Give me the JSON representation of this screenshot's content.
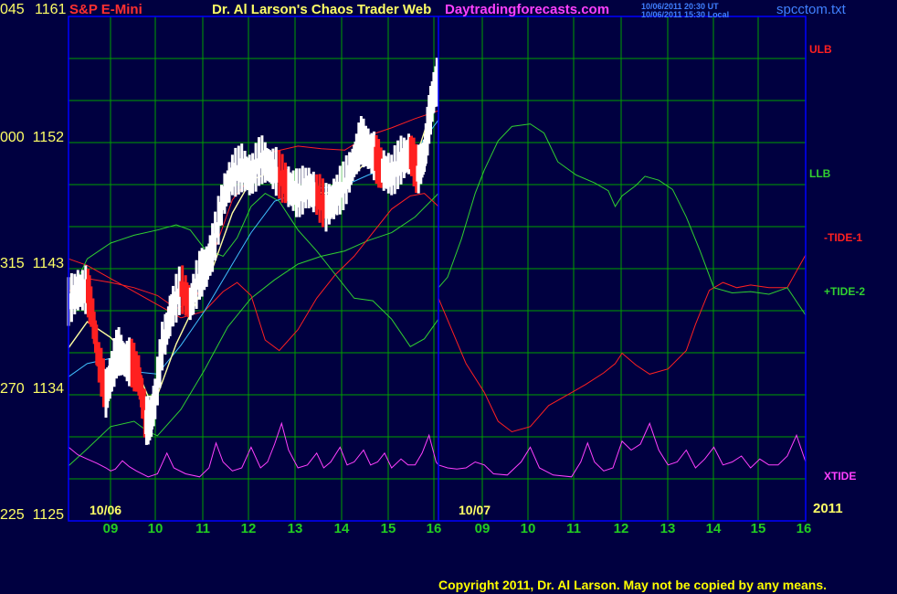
{
  "header": {
    "instrument": "S&P E-Mini",
    "site_title": "Dr. Al Larson's Chaos Trader Web",
    "site_url": "Daytradingforecasts.com",
    "ts_ut": "10/06/2011 20:30 UT",
    "ts_local": "10/06/2011 15:30 Local",
    "file_name": "spcctom.txt",
    "left_cut": "045"
  },
  "copyright": "Copyright 2011, Dr. Al Larson. May not be copied by any means.",
  "colors": {
    "background": "#000040",
    "grid": "#00a000",
    "frame": "#0000ff",
    "ulb": "#ff2020",
    "llb": "#30d030",
    "xtide": "#ff40ff",
    "price_up": "#ffffff",
    "price_down": "#ff2020",
    "avg_fast": "#ffffa0",
    "avg_slow": "#40c0ff",
    "copyright": "#ffff00"
  },
  "chart_data": {
    "type": "line",
    "title": "S&P E-Mini",
    "ylim": [
      1125,
      1163.5
    ],
    "xlim": [
      8.1,
      16.0
    ],
    "y_ticks": [
      {
        "left": "045",
        "value": 1161
      },
      {
        "left": "000",
        "value": 1152
      },
      {
        "left": "315",
        "value": 1143
      },
      {
        "left": "270",
        "value": 1134
      },
      {
        "left": "225",
        "value": 1125
      }
    ],
    "dates": [
      {
        "label": "10/06"
      },
      {
        "label": "10/07"
      }
    ],
    "year_label": "2011",
    "x_hours": [
      "09",
      "10",
      "11",
      "12",
      "13",
      "14",
      "15",
      "16"
    ],
    "legend": [
      {
        "label": "ULB",
        "color": "#ff2020"
      },
      {
        "label": "LLB",
        "color": "#30d030"
      },
      {
        "label": "-TIDE-1",
        "color": "#ff2020"
      },
      {
        "label": "+TIDE-2",
        "color": "#30d030"
      },
      {
        "label": "XTIDE",
        "color": "#ff40ff"
      }
    ],
    "price_close": [
      [
        8.1,
        1141.6
      ],
      [
        8.3,
        1142.5
      ],
      [
        8.5,
        1142.5
      ],
      [
        8.6,
        1141
      ],
      [
        8.75,
        1137
      ],
      [
        8.9,
        1134.6
      ],
      [
        9.0,
        1136
      ],
      [
        9.15,
        1137.9
      ],
      [
        9.3,
        1137.2
      ],
      [
        9.45,
        1136.9
      ],
      [
        9.6,
        1136
      ],
      [
        9.75,
        1132.5
      ],
      [
        9.85,
        1132.6
      ],
      [
        9.95,
        1134.2
      ],
      [
        10.1,
        1138.2
      ],
      [
        10.3,
        1141
      ],
      [
        10.5,
        1142.7
      ],
      [
        10.7,
        1141.5
      ],
      [
        10.9,
        1143.6
      ],
      [
        11.05,
        1144.3
      ],
      [
        11.2,
        1146
      ],
      [
        11.4,
        1149.6
      ],
      [
        11.6,
        1151.3
      ],
      [
        11.8,
        1151.8
      ],
      [
        12.0,
        1151.2
      ],
      [
        12.2,
        1152.5
      ],
      [
        12.4,
        1152
      ],
      [
        12.6,
        1151.3
      ],
      [
        12.8,
        1150.4
      ],
      [
        13.0,
        1149.8
      ],
      [
        13.2,
        1150.4
      ],
      [
        13.4,
        1149.8
      ],
      [
        13.6,
        1148.8
      ],
      [
        13.8,
        1149.6
      ],
      [
        14.0,
        1150.6
      ],
      [
        14.2,
        1152.4
      ],
      [
        14.35,
        1153.9
      ],
      [
        14.5,
        1153.3
      ],
      [
        14.65,
        1152.6
      ],
      [
        14.8,
        1151.7
      ],
      [
        15.0,
        1151.3
      ],
      [
        15.2,
        1152.4
      ],
      [
        15.4,
        1153
      ],
      [
        15.55,
        1151.5
      ],
      [
        15.7,
        1152.8
      ],
      [
        15.8,
        1155.5
      ],
      [
        15.9,
        1157.6
      ],
      [
        15.98,
        1158.5
      ]
    ],
    "ulb": [
      [
        8.1,
        1142.5
      ],
      [
        8.5,
        1143.5
      ],
      [
        9.0,
        1143.2
      ],
      [
        9.5,
        1142.8
      ],
      [
        10.0,
        1142.2
      ],
      [
        10.4,
        1141.2
      ],
      [
        10.8,
        1141.8
      ],
      [
        11.0,
        1143.5
      ],
      [
        11.3,
        1146.5
      ],
      [
        11.6,
        1149.5
      ],
      [
        12.0,
        1151.3
      ],
      [
        12.5,
        1153.2
      ],
      [
        13.0,
        1153.6
      ],
      [
        13.5,
        1153.4
      ],
      [
        14.0,
        1153.3
      ],
      [
        14.5,
        1154.4
      ],
      [
        15.0,
        1155
      ],
      [
        15.5,
        1155.7
      ],
      [
        16.0,
        1156.3
      ]
    ],
    "llb": [
      [
        8.1,
        1129.2
      ],
      [
        8.5,
        1130.5
      ],
      [
        9.0,
        1132.2
      ],
      [
        9.5,
        1132.6
      ],
      [
        9.8,
        1131.8
      ],
      [
        10.0,
        1131.5
      ],
      [
        10.5,
        1133.5
      ],
      [
        11.0,
        1136.5
      ],
      [
        11.5,
        1139.8
      ],
      [
        12.0,
        1142
      ],
      [
        12.5,
        1143.4
      ],
      [
        13.0,
        1144.6
      ],
      [
        13.5,
        1145.2
      ],
      [
        14.0,
        1145.6
      ],
      [
        14.5,
        1146.4
      ],
      [
        15.0,
        1147
      ],
      [
        15.5,
        1148.2
      ],
      [
        16.0,
        1150
      ]
    ],
    "avg_fast": [
      [
        8.1,
        1138.2
      ],
      [
        8.5,
        1140.2
      ],
      [
        9.0,
        1139
      ],
      [
        9.5,
        1137
      ],
      [
        9.8,
        1134.5
      ],
      [
        10.0,
        1134.6
      ],
      [
        10.4,
        1138.5
      ],
      [
        10.8,
        1141.5
      ],
      [
        11.2,
        1144.5
      ],
      [
        11.6,
        1148.5
      ],
      [
        12.0,
        1151
      ],
      [
        12.4,
        1151.6
      ],
      [
        12.8,
        1150.8
      ],
      [
        13.2,
        1150.2
      ],
      [
        13.6,
        1150
      ],
      [
        14.0,
        1150.6
      ],
      [
        14.4,
        1152.2
      ],
      [
        14.8,
        1152.2
      ],
      [
        15.2,
        1152.4
      ],
      [
        15.6,
        1153.6
      ],
      [
        16.0,
        1158
      ]
    ],
    "avg_slow": [
      [
        8.1,
        1136
      ],
      [
        8.5,
        1137
      ],
      [
        9.0,
        1137.4
      ],
      [
        9.5,
        1136.4
      ],
      [
        10.0,
        1136.2
      ],
      [
        10.5,
        1138.4
      ],
      [
        11.0,
        1141
      ],
      [
        11.5,
        1144
      ],
      [
        12.0,
        1147
      ],
      [
        12.5,
        1149.4
      ],
      [
        13.0,
        1150
      ],
      [
        13.5,
        1150.4
      ],
      [
        14.0,
        1150.6
      ],
      [
        14.5,
        1151.4
      ],
      [
        15.0,
        1152
      ],
      [
        15.5,
        1153.2
      ],
      [
        16.0,
        1155.6
      ]
    ],
    "tide1": [
      [
        8.1,
        1145
      ],
      [
        8.5,
        1144.5
      ],
      [
        9.0,
        1143.5
      ],
      [
        9.5,
        1142.5
      ],
      [
        10.0,
        1141.5
      ],
      [
        10.5,
        1140.5
      ],
      [
        11.0,
        1141
      ],
      [
        11.4,
        1142.5
      ],
      [
        11.7,
        1143.2
      ],
      [
        12.0,
        1142.2
      ],
      [
        12.3,
        1138.8
      ],
      [
        12.6,
        1138
      ],
      [
        13.0,
        1139.6
      ],
      [
        13.4,
        1142
      ],
      [
        13.8,
        1143.8
      ],
      [
        14.2,
        1145.2
      ],
      [
        14.6,
        1147
      ],
      [
        15.0,
        1148.8
      ],
      [
        15.4,
        1149.8
      ],
      [
        15.7,
        1150
      ],
      [
        16.0,
        1149
      ]
    ],
    "tide2": [
      [
        8.1,
        1142
      ],
      [
        8.5,
        1145
      ],
      [
        9.0,
        1146.2
      ],
      [
        9.5,
        1146.8
      ],
      [
        10.0,
        1147.2
      ],
      [
        10.4,
        1147.6
      ],
      [
        10.7,
        1147.2
      ],
      [
        11.0,
        1145.8
      ],
      [
        11.4,
        1145.2
      ],
      [
        11.7,
        1146.6
      ],
      [
        12.0,
        1149
      ],
      [
        12.3,
        1150
      ],
      [
        12.6,
        1149.4
      ],
      [
        13.0,
        1147.2
      ],
      [
        13.4,
        1145.6
      ],
      [
        13.8,
        1143.8
      ],
      [
        14.2,
        1142
      ],
      [
        14.6,
        1141.8
      ],
      [
        15.0,
        1140.4
      ],
      [
        15.4,
        1138.3
      ],
      [
        15.7,
        1138.9
      ],
      [
        16.0,
        1140.4
      ]
    ],
    "xtide_min": 0,
    "xtide_max": 1,
    "xtide": [
      [
        8.1,
        0.55
      ],
      [
        8.3,
        0.42
      ],
      [
        8.5,
        0.35
      ],
      [
        8.7,
        0.28
      ],
      [
        8.9,
        0.2
      ],
      [
        9.0,
        0.15
      ],
      [
        9.1,
        0.18
      ],
      [
        9.25,
        0.32
      ],
      [
        9.4,
        0.22
      ],
      [
        9.55,
        0.15
      ],
      [
        9.8,
        0.05
      ],
      [
        10.0,
        0.1
      ],
      [
        10.2,
        0.45
      ],
      [
        10.35,
        0.2
      ],
      [
        10.6,
        0.1
      ],
      [
        10.9,
        0.05
      ],
      [
        11.1,
        0.2
      ],
      [
        11.25,
        0.62
      ],
      [
        11.4,
        0.3
      ],
      [
        11.6,
        0.15
      ],
      [
        11.8,
        0.2
      ],
      [
        12.0,
        0.55
      ],
      [
        12.2,
        0.2
      ],
      [
        12.35,
        0.3
      ],
      [
        12.5,
        0.6
      ],
      [
        12.65,
        0.95
      ],
      [
        12.8,
        0.5
      ],
      [
        13.0,
        0.2
      ],
      [
        13.2,
        0.25
      ],
      [
        13.4,
        0.45
      ],
      [
        13.55,
        0.2
      ],
      [
        13.7,
        0.3
      ],
      [
        13.9,
        0.55
      ],
      [
        14.05,
        0.25
      ],
      [
        14.2,
        0.3
      ],
      [
        14.4,
        0.5
      ],
      [
        14.55,
        0.25
      ],
      [
        14.7,
        0.3
      ],
      [
        14.85,
        0.45
      ],
      [
        15.0,
        0.2
      ],
      [
        15.2,
        0.35
      ],
      [
        15.35,
        0.25
      ],
      [
        15.5,
        0.25
      ],
      [
        15.65,
        0.45
      ],
      [
        15.8,
        0.75
      ],
      [
        15.95,
        0.3
      ],
      [
        16.0,
        0.25
      ],
      [
        16.2,
        0.2
      ],
      [
        16.4,
        0.18
      ],
      [
        16.6,
        0.2
      ],
      [
        16.8,
        0.3
      ],
      [
        17.0,
        0.25
      ],
      [
        17.2,
        0.1
      ],
      [
        17.5,
        0.08
      ],
      [
        17.8,
        0.3
      ],
      [
        18.0,
        0.55
      ],
      [
        18.2,
        0.2
      ],
      [
        18.5,
        0.08
      ],
      [
        18.9,
        0.05
      ],
      [
        19.1,
        0.3
      ],
      [
        19.25,
        0.62
      ],
      [
        19.4,
        0.3
      ],
      [
        19.6,
        0.15
      ],
      [
        19.8,
        0.2
      ],
      [
        20.0,
        0.65
      ],
      [
        20.2,
        0.5
      ],
      [
        20.4,
        0.6
      ],
      [
        20.6,
        0.95
      ],
      [
        20.8,
        0.5
      ],
      [
        21.0,
        0.25
      ],
      [
        21.2,
        0.3
      ],
      [
        21.4,
        0.5
      ],
      [
        21.6,
        0.2
      ],
      [
        21.8,
        0.35
      ],
      [
        22.0,
        0.55
      ],
      [
        22.2,
        0.25
      ],
      [
        22.4,
        0.3
      ],
      [
        22.6,
        0.4
      ],
      [
        22.8,
        0.2
      ],
      [
        23.0,
        0.35
      ],
      [
        23.2,
        0.25
      ],
      [
        23.4,
        0.25
      ],
      [
        23.6,
        0.4
      ],
      [
        23.8,
        0.75
      ],
      [
        24.0,
        0.3
      ]
    ],
    "tide1_next": [
      [
        16.0,
        1142
      ],
      [
        16.3,
        1139.5
      ],
      [
        16.6,
        1137
      ],
      [
        17.0,
        1134.8
      ],
      [
        17.3,
        1132.6
      ],
      [
        17.6,
        1131.8
      ],
      [
        18.0,
        1132.2
      ],
      [
        18.4,
        1133.8
      ],
      [
        18.8,
        1134.6
      ],
      [
        19.2,
        1135.4
      ],
      [
        19.6,
        1136.3
      ],
      [
        19.85,
        1137
      ],
      [
        20.0,
        1137.8
      ],
      [
        20.3,
        1136.9
      ],
      [
        20.6,
        1136.2
      ],
      [
        21.0,
        1136.6
      ],
      [
        21.4,
        1138
      ],
      [
        21.6,
        1140
      ],
      [
        21.9,
        1142.6
      ],
      [
        22.2,
        1143.2
      ],
      [
        22.5,
        1142.8
      ],
      [
        22.8,
        1143
      ],
      [
        23.2,
        1142.8
      ],
      [
        23.6,
        1142.8
      ],
      [
        24.0,
        1145.3
      ]
    ],
    "tide2_next": [
      [
        16.0,
        1142.8
      ],
      [
        16.2,
        1143.6
      ],
      [
        16.5,
        1146.5
      ],
      [
        16.8,
        1150
      ],
      [
        17.0,
        1151.8
      ],
      [
        17.3,
        1154
      ],
      [
        17.6,
        1155.1
      ],
      [
        18.0,
        1155.3
      ],
      [
        18.3,
        1154.6
      ],
      [
        18.6,
        1152.4
      ],
      [
        19.0,
        1151.4
      ],
      [
        19.4,
        1150.8
      ],
      [
        19.7,
        1150.2
      ],
      [
        19.85,
        1149
      ],
      [
        20.0,
        1149.8
      ],
      [
        20.3,
        1150.6
      ],
      [
        20.5,
        1151.3
      ],
      [
        20.8,
        1151
      ],
      [
        21.1,
        1150.3
      ],
      [
        21.4,
        1148.2
      ],
      [
        21.7,
        1145.6
      ],
      [
        22.0,
        1142.8
      ],
      [
        22.4,
        1142.4
      ],
      [
        22.8,
        1142.5
      ],
      [
        23.2,
        1142.3
      ],
      [
        23.6,
        1142.8
      ],
      [
        24.0,
        1140.7
      ]
    ]
  }
}
